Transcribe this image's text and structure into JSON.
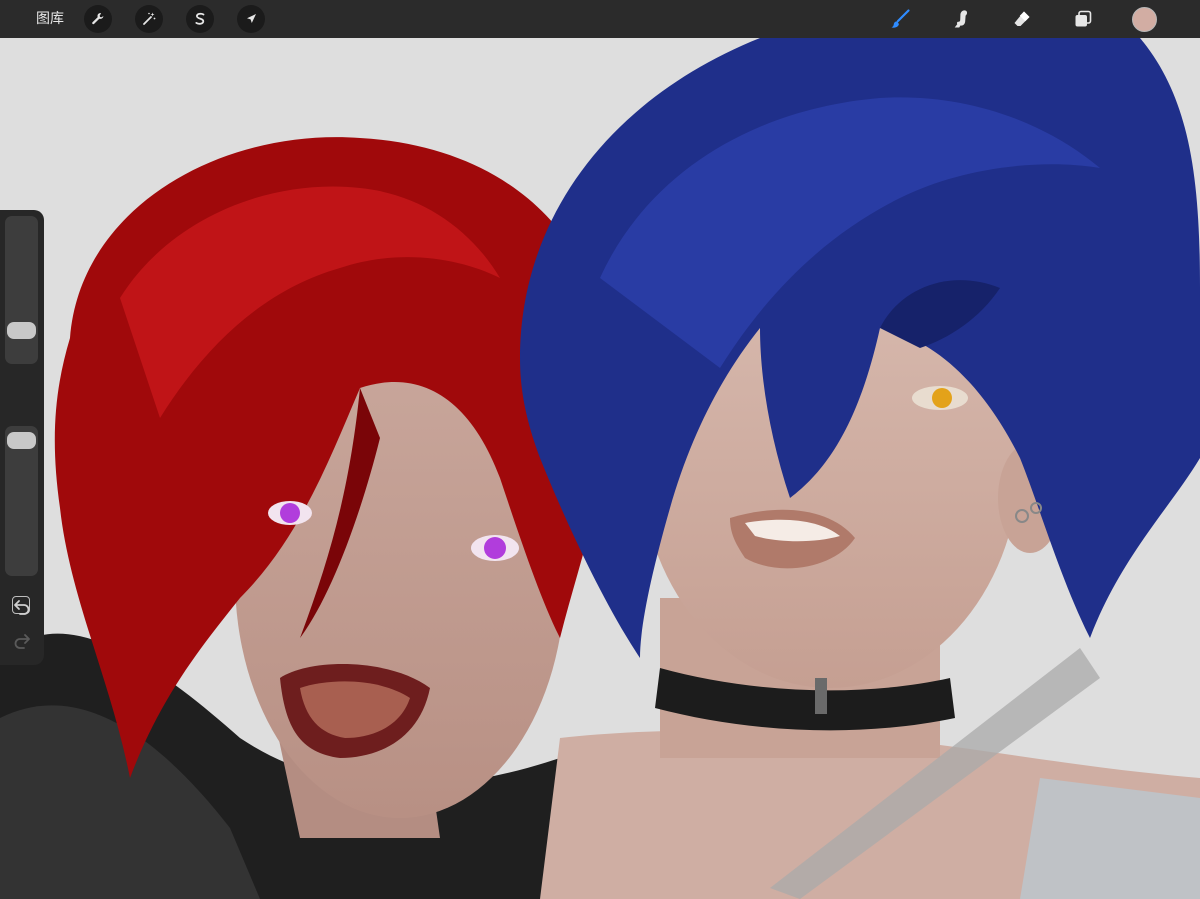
{
  "topbar": {
    "gallery_label": "图库",
    "left_tools": [
      "wrench-icon",
      "magic-wand-icon",
      "selection-icon",
      "move-arrow-icon"
    ],
    "right_tools": [
      "brush-icon",
      "smudge-icon",
      "eraser-icon",
      "layers-icon"
    ],
    "active_tool": "brush-icon",
    "active_color": "#d2ada3",
    "accent_color": "#2f8cff"
  },
  "sidebar": {
    "brush_size_level": 0.18,
    "opacity_level": 0.97,
    "icons": [
      "modify-square-icon",
      "undo-icon",
      "redo-icon"
    ]
  },
  "canvas": {
    "background": "#dedede",
    "red_hair": "#a0090b",
    "blue_hair": "#1f2f8a",
    "skin": "#d7b3a5"
  }
}
